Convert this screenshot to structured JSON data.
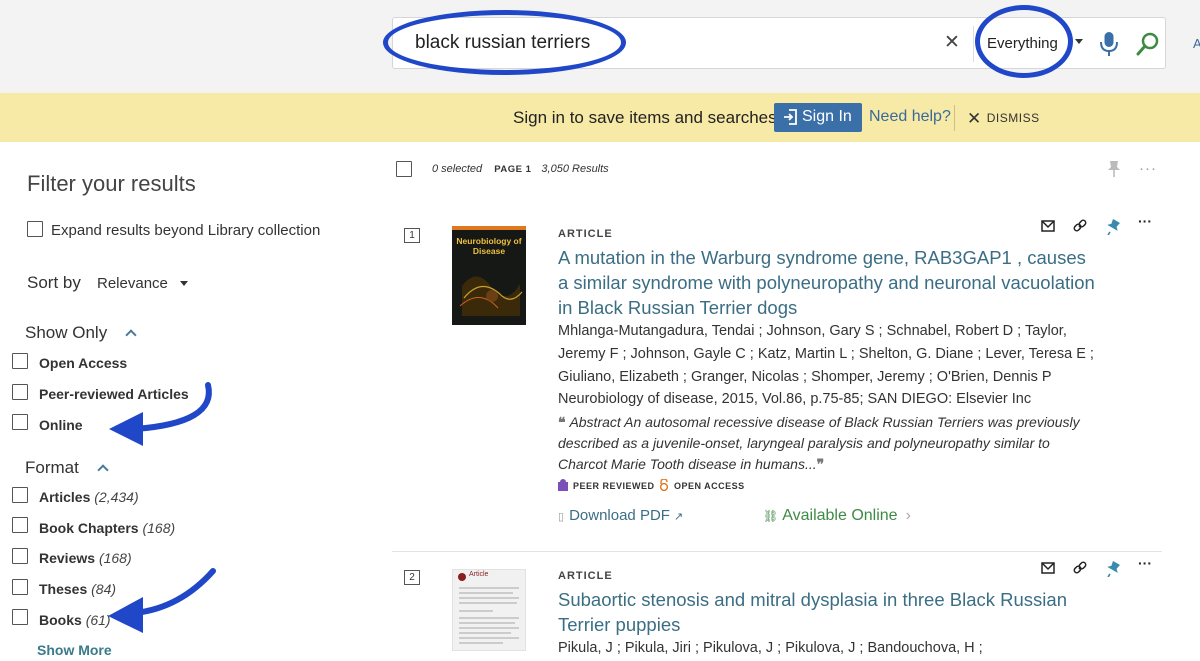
{
  "search": {
    "query": "black russian terriers",
    "scope": "Everything",
    "edge_text": "A"
  },
  "banner": {
    "message": "Sign in to save items and searches",
    "signin_label": "Sign In",
    "help_label": "Need help?",
    "dismiss_label": "DISMISS"
  },
  "filters": {
    "title": "Filter your results",
    "expand_label": "Expand results beyond Library collection",
    "sort_label": "Sort by",
    "sort_value": "Relevance",
    "show_only": {
      "heading": "Show Only",
      "items": [
        {
          "label": "Open Access"
        },
        {
          "label": "Peer-reviewed Articles"
        },
        {
          "label": "Online"
        }
      ]
    },
    "format": {
      "heading": "Format",
      "items": [
        {
          "label": "Articles",
          "count": "(2,434)"
        },
        {
          "label": "Book Chapters",
          "count": "(168)"
        },
        {
          "label": "Reviews",
          "count": "(168)"
        },
        {
          "label": "Theses",
          "count": "(84)"
        },
        {
          "label": "Books",
          "count": "(61)"
        }
      ],
      "show_more": "Show More"
    }
  },
  "results_header": {
    "selected": "0 selected",
    "page": "PAGE 1",
    "count": "3,050 Results"
  },
  "results": [
    {
      "number": "1",
      "thumb_title": "Neurobiology of Disease",
      "type": "ARTICLE",
      "title": "A mutation in the Warburg syndrome gene, RAB3GAP1 , causes a similar syndrome with polyneuropathy and neuronal vacuolation in Black Russian Terrier dogs",
      "authors": "Mhlanga-Mutangadura, Tendai ; Johnson, Gary S ; Schnabel, Robert D ; Taylor, Jeremy F ; Johnson, Gayle C ; Katz, Martin L ; Shelton, G. Diane ; Lever, Teresa E ; Giuliano, Elizabeth ; Granger, Nicolas ; Shomper, Jeremy ; O'Brien, Dennis P",
      "citation": "Neurobiology of disease, 2015, Vol.86, p.75-85; SAN DIEGO: Elsevier Inc",
      "abstract": "Abstract An autosomal recessive disease of Black Russian Terriers was previously described as a juvenile-onset, laryngeal paralysis and polyneuropathy similar to Charcot Marie Tooth disease in humans...",
      "badges": [
        "PEER REVIEWED",
        "OPEN ACCESS"
      ],
      "pdf_label": "Download PDF",
      "online_label": "Available Online"
    },
    {
      "number": "2",
      "thumb_title": "Article",
      "type": "ARTICLE",
      "title": "Subaortic stenosis and mitral dysplasia in three Black Russian Terrier puppies",
      "authors": "Pikula, J ; Pikula, Jiri ; Pikulova, J ; Pikulova, J ; Bandouchova, H ;"
    }
  ],
  "colors": {
    "accent_blue": "#3a6fa8",
    "banner_yellow": "#f7e9a6",
    "link_teal": "#3b6e84",
    "online_green": "#3e8a44",
    "annotation_blue": "#1f47c8"
  }
}
